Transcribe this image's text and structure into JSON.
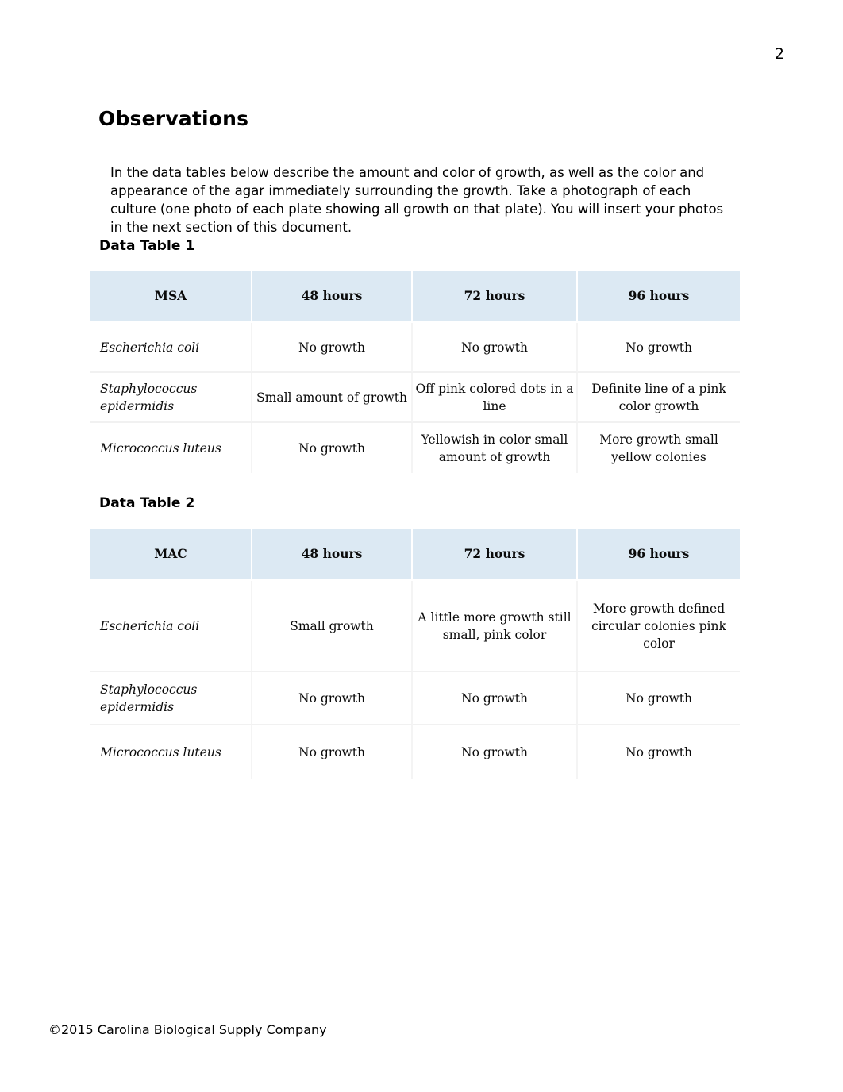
{
  "page": {
    "number": "2"
  },
  "heading": "Observations",
  "intro": "In the data tables below describe the amount and color of growth, as well as the color and appearance of the agar immediately surrounding the growth. Take a photograph of each culture (one photo of each plate showing all growth on that plate).   You will insert your photos in the next section of this document.",
  "footer": "©2015 Carolina Biological Supply Company",
  "colors": {
    "header_fill": "#dce9f3",
    "text": "#000000",
    "cell_divider": "#f1f1f1"
  },
  "tables": [
    {
      "caption": "Data Table 1",
      "headers": [
        "MSA",
        "48 hours",
        "72 hours",
        "96 hours"
      ],
      "rows": [
        {
          "species": "Escherichia coli",
          "cells": [
            "No growth",
            "No growth",
            "No growth"
          ]
        },
        {
          "species": "Staphylococcus epidermidis",
          "cells": [
            "Small amount of growth",
            "Off pink colored dots in a line",
            "Definite line of a pink color growth"
          ]
        },
        {
          "species": "Micrococcus luteus",
          "cells": [
            "No growth",
            "Yellowish in color small amount of growth",
            "More growth small yellow colonies"
          ]
        }
      ]
    },
    {
      "caption": "Data Table 2",
      "headers": [
        "MAC",
        "48 hours",
        "72 hours",
        "96 hours"
      ],
      "rows": [
        {
          "species": "Escherichia coli",
          "cells": [
            "Small growth",
            "A little more growth still small, pink color",
            "More growth defined circular colonies pink color"
          ]
        },
        {
          "species": "Staphylococcus epidermidis",
          "cells": [
            "No growth",
            "No growth",
            "No growth"
          ]
        },
        {
          "species": "Micrococcus luteus",
          "cells": [
            "No growth",
            "No growth",
            "No growth"
          ]
        }
      ]
    }
  ]
}
